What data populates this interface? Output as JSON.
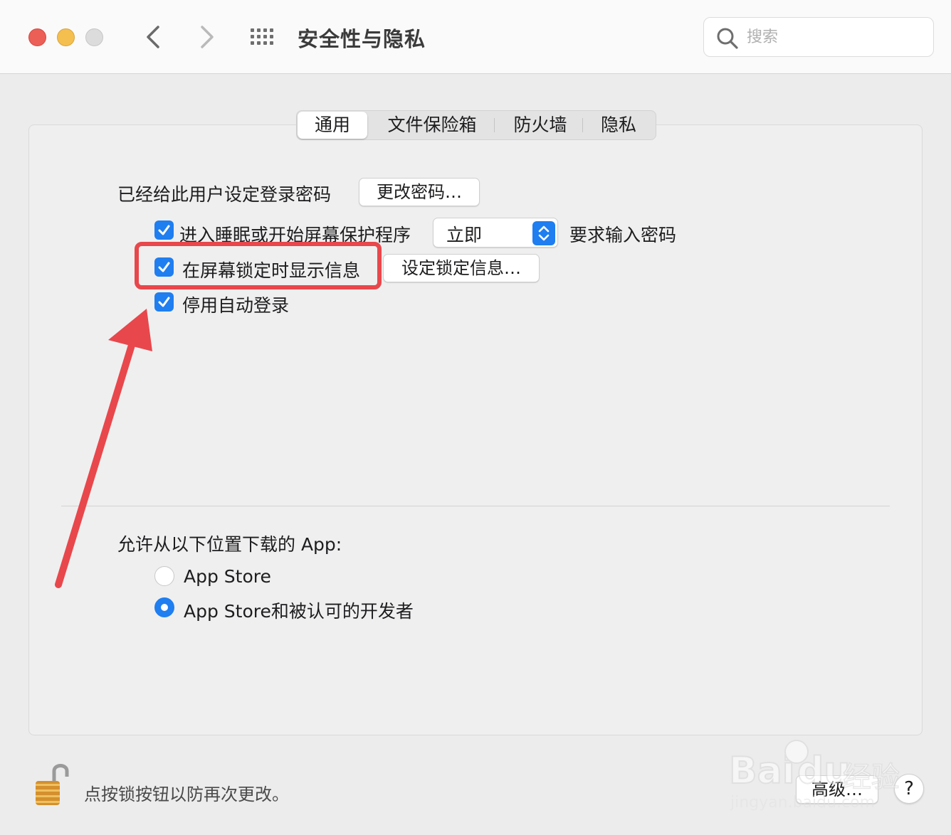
{
  "window": {
    "title": "安全性与隐私",
    "search_placeholder": "搜索"
  },
  "tabs": [
    {
      "label": "通用",
      "active": true
    },
    {
      "label": "文件保险箱",
      "active": false
    },
    {
      "label": "防火墙",
      "active": false
    },
    {
      "label": "隐私",
      "active": false
    }
  ],
  "general": {
    "password_set_label": "已经给此用户设定登录密码",
    "change_password_button": "更改密码…",
    "require_password": {
      "checked": true,
      "label": "进入睡眠或开始屏幕保护程序",
      "popup_value": "立即",
      "suffix": "要求输入密码"
    },
    "show_message": {
      "checked": true,
      "label": "在屏幕锁定时显示信息",
      "button": "设定锁定信息…"
    },
    "disable_autologin": {
      "checked": true,
      "label": "停用自动登录"
    }
  },
  "downloads": {
    "heading": "允许从以下位置下载的 App:",
    "options": [
      {
        "label": "App Store",
        "selected": false
      },
      {
        "label": "App Store和被认可的开发者",
        "selected": true
      }
    ]
  },
  "footer": {
    "lock_text": "点按锁按钮以防再次更改。",
    "advanced_button": "高级…",
    "help_button": "?"
  },
  "annotation": {
    "color": "#e8474c"
  },
  "watermark": {
    "brand": "Bai",
    "brand2": "du",
    "cn": "经验",
    "url": "jingyan.baidu.com"
  },
  "colors": {
    "accent": "#1f7ef0",
    "traffic_red": "#ec5f57",
    "traffic_yellow": "#f5bf4f"
  }
}
